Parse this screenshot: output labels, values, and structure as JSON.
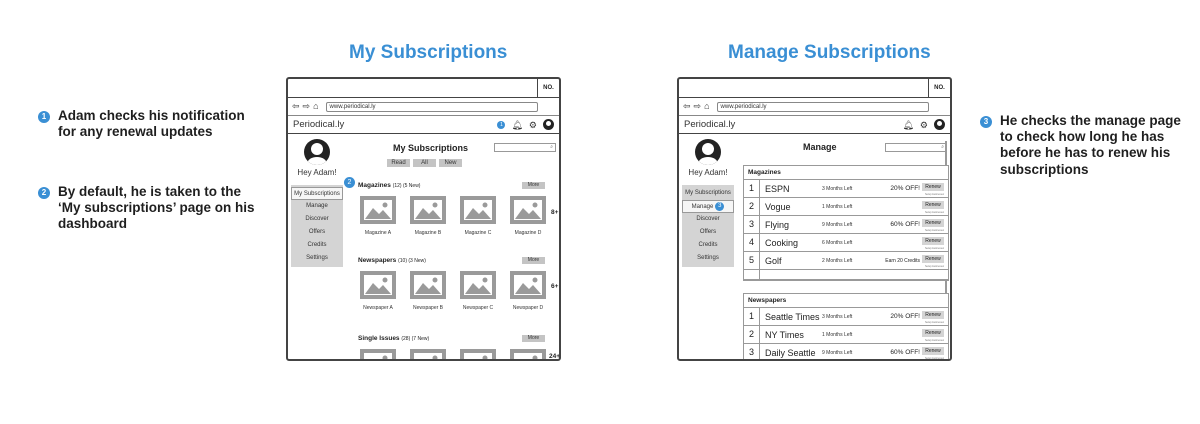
{
  "left_heading": "My Subscriptions",
  "right_heading": "Manage Subscriptions",
  "notes": [
    {
      "num": "1",
      "text": "Adam checks his notification for any renewal updates"
    },
    {
      "num": "2",
      "text": "By default, he is taken to the ‘My subscriptions’ page on his dashboard"
    },
    {
      "num": "3",
      "text": "He checks the manage page to check how long he has before he has to renew his subscriptions"
    }
  ],
  "browser": {
    "no_label": "NO.",
    "url": "www.periodical.ly",
    "back_icon": "back-arrow-icon",
    "forward_icon": "forward-arrow-icon",
    "home_icon": "home-icon",
    "notification_count": "1"
  },
  "app": {
    "logo": "Periodical.ly",
    "greeting": "Hey Adam!",
    "menu": [
      "My Subscriptions",
      "Manage",
      "Discover",
      "Offers",
      "Credits",
      "Settings"
    ]
  },
  "subs_page": {
    "title": "My Subscriptions",
    "filters": [
      "Read",
      "All",
      "New"
    ],
    "more_label": "More",
    "sections": [
      {
        "name": "Magazines",
        "count": "(12) (5 New)",
        "items": [
          "Magazine A",
          "Magazine B",
          "Magazine C",
          "Magazine D"
        ],
        "plus": "8+"
      },
      {
        "name": "Newspapers",
        "count": "(10) (3 New)",
        "items": [
          "Newspaper A",
          "Newspaper B",
          "Newspaper C",
          "Newspaper D"
        ],
        "plus": "6+"
      },
      {
        "name": "Single Issues",
        "count": "(28) (7 New)",
        "plus": "24+"
      }
    ]
  },
  "manage_page": {
    "title": "Manage",
    "renew_label": "Renew",
    "renew_note": "Setup Autorenew",
    "magazines_header": "Magazines",
    "magazines": [
      {
        "n": "1",
        "name": "ESPN",
        "left": "3 Months Left",
        "offer": "20% OFF!"
      },
      {
        "n": "2",
        "name": "Vogue",
        "left": "1 Months Left",
        "offer": ""
      },
      {
        "n": "3",
        "name": "Flying",
        "left": "9 Months Left",
        "offer": "60% OFF!"
      },
      {
        "n": "4",
        "name": "Cooking",
        "left": "6 Months Left",
        "offer": ""
      },
      {
        "n": "5",
        "name": "Golf",
        "left": "2 Months Left",
        "offer": "Earn 20 Credits"
      }
    ],
    "newspapers_header": "Newspapers",
    "newspapers": [
      {
        "n": "1",
        "name": "Seattle Times",
        "left": "3 Months Left",
        "offer": "20% OFF!"
      },
      {
        "n": "2",
        "name": "NY Times",
        "left": "1 Months Left",
        "offer": ""
      },
      {
        "n": "3",
        "name": "Daily Seattle",
        "left": "9 Months Left",
        "offer": "60% OFF!"
      }
    ]
  }
}
